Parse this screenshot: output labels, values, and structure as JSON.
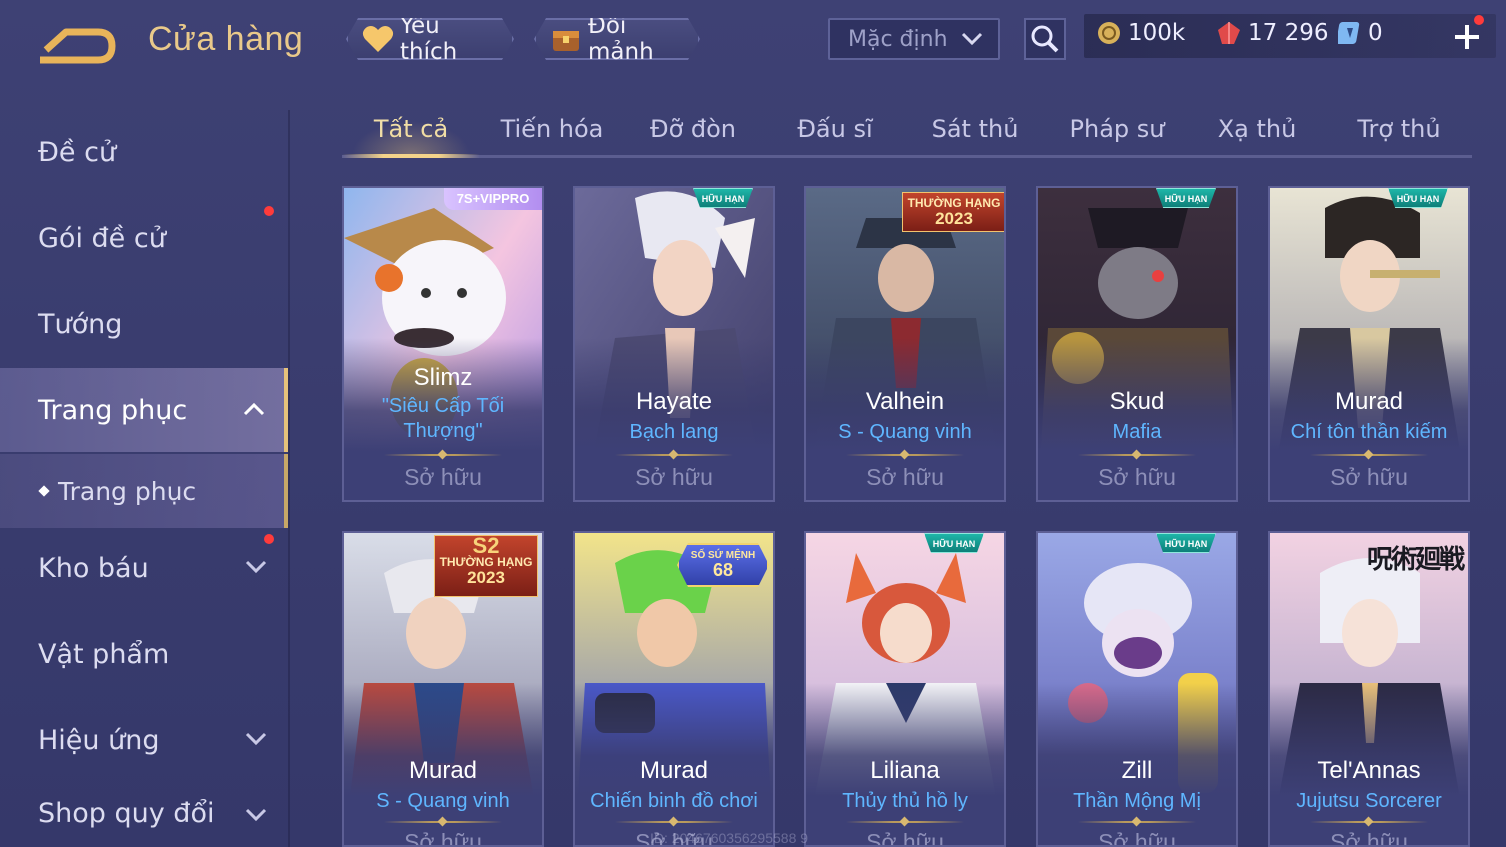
{
  "header": {
    "title": "Cửa hàng",
    "favorite_label": "Yêu thích",
    "shard_label": "Đổi mảnh",
    "sort_value": "Mặc định"
  },
  "currency": {
    "coins": "100k",
    "gems": "17 296",
    "vouchers": "0"
  },
  "sidebar": {
    "items": [
      {
        "label": "Đề cử"
      },
      {
        "label": "Gói đề cử"
      },
      {
        "label": "Tướng"
      },
      {
        "label": "Trang phục"
      },
      {
        "label": "Trang phục"
      },
      {
        "label": "Kho báu"
      },
      {
        "label": "Vật phẩm"
      },
      {
        "label": "Hiệu ứng"
      },
      {
        "label": "Shop quy đổi"
      }
    ]
  },
  "tabs": [
    {
      "label": "Tất cả"
    },
    {
      "label": "Tiến hóa"
    },
    {
      "label": "Đỡ đòn"
    },
    {
      "label": "Đấu sĩ"
    },
    {
      "label": "Sát thủ"
    },
    {
      "label": "Pháp sư"
    },
    {
      "label": "Xạ thủ"
    },
    {
      "label": "Trợ thủ"
    }
  ],
  "cards": [
    {
      "hero": "Slimz",
      "skin": "\"Siêu Cấp Tối Thượng\"",
      "status": "Sở hữu",
      "badge": "7S+VIPPRO"
    },
    {
      "hero": "Hayate",
      "skin": "Bạch lang",
      "status": "Sở hữu",
      "badge": "HỮU HẠN"
    },
    {
      "hero": "Valhein",
      "skin": "S - Quang vinh",
      "status": "Sở hữu",
      "badge": "THƯỜNG HẠNG",
      "badge_year": "2023"
    },
    {
      "hero": "Skud",
      "skin": "Mafia",
      "status": "Sở hữu",
      "badge": "HỮU HẠN"
    },
    {
      "hero": "Murad",
      "skin": "Chí tôn thần kiếm",
      "status": "Sở hữu",
      "badge": "HỮU HẠN"
    },
    {
      "hero": "Murad",
      "skin": "S - Quang vinh",
      "status": "Sở hữu",
      "badge": "THƯỜNG HẠNG",
      "badge_top": "S2",
      "badge_year": "2023"
    },
    {
      "hero": "Murad",
      "skin": "Chiến binh đồ chơi",
      "status": "Sở hữu",
      "badge": "SỐ SỨ MỆNH",
      "badge_num": "68"
    },
    {
      "hero": "Liliana",
      "skin": "Thủy thủ hồ ly",
      "status": "Sở hữu",
      "badge": "HỮU HẠN"
    },
    {
      "hero": "Zill",
      "skin": "Thần Mộng Mị",
      "status": "Sở hữu",
      "badge": "HỮU HẠN"
    },
    {
      "hero": "Tel'Annas",
      "skin": "Jujutsu Sorcerer",
      "status": "Sở hữu",
      "badge": "呪術廻戦"
    }
  ],
  "watermark": "ID: 2046760356295588 9",
  "colors": {
    "accent_gold": "#e9c98a",
    "skin_blue": "#5fb6ff",
    "bg": "#3e4174",
    "notify_red": "#ff3b3b"
  }
}
